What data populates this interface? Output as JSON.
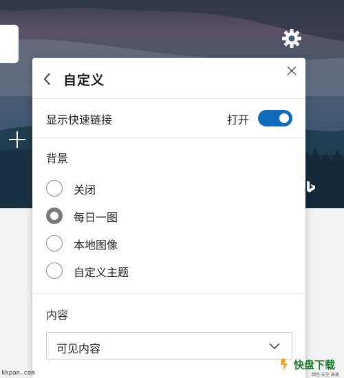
{
  "panel": {
    "title": "自定义",
    "quick_links": {
      "label": "显示快速链接",
      "state_label": "打开",
      "enabled": true
    },
    "background": {
      "title": "背景",
      "options": [
        {
          "label": "关闭",
          "selected": false
        },
        {
          "label": "每日一图",
          "selected": true
        },
        {
          "label": "本地图像",
          "selected": false
        },
        {
          "label": "自定义主题",
          "selected": false
        }
      ]
    },
    "content": {
      "title": "内容",
      "selected": "可见内容"
    }
  },
  "watermark": {
    "left_url": "kkpan.com",
    "right_text": "快盘下载",
    "right_sub": "绿色·安全·高速"
  },
  "colors": {
    "accent": "#0f6cbd"
  },
  "icons": [
    "gear-icon",
    "add-icon",
    "bing-icon",
    "back-chevron-icon",
    "close-icon",
    "chevron-down-icon"
  ]
}
